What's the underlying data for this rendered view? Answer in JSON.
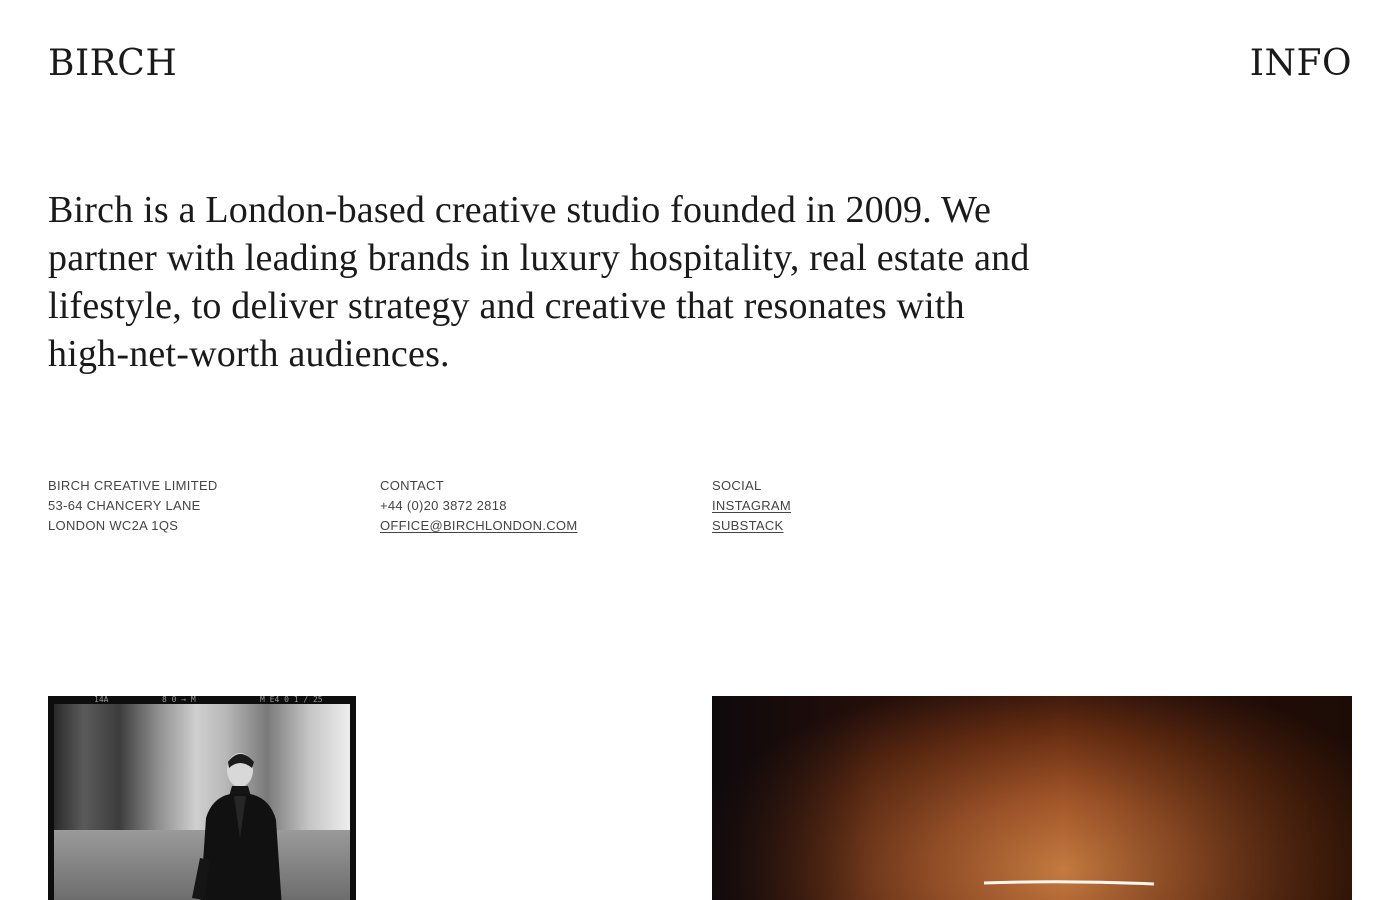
{
  "header": {
    "logo": "BIRCH",
    "nav_info": "INFO"
  },
  "intro": {
    "text": "Birch is a London-based creative studio founded in 2009. We partner with leading brands in luxury hospitality, real estate and lifestyle, to deliver strategy and creative that resonates with high-net-worth audiences."
  },
  "company": {
    "name": "BIRCH CREATIVE LIMITED",
    "address_line1": "53-64 CHANCERY LANE",
    "address_line2": "LONDON WC2A 1QS"
  },
  "contact": {
    "heading": "CONTACT",
    "phone": "+44 (0)20 3872 2818",
    "email": "OFFICE@BIRCHLONDON.COM"
  },
  "social": {
    "heading": "SOCIAL",
    "links": [
      "INSTAGRAM",
      "SUBSTACK"
    ]
  },
  "photos": {
    "left_film_marks": [
      "14A",
      "8 0 → M",
      "M E4 0 1 / 25"
    ]
  },
  "colors": {
    "text": "#1a1a1a",
    "muted": "#444444",
    "background": "#ffffff"
  }
}
